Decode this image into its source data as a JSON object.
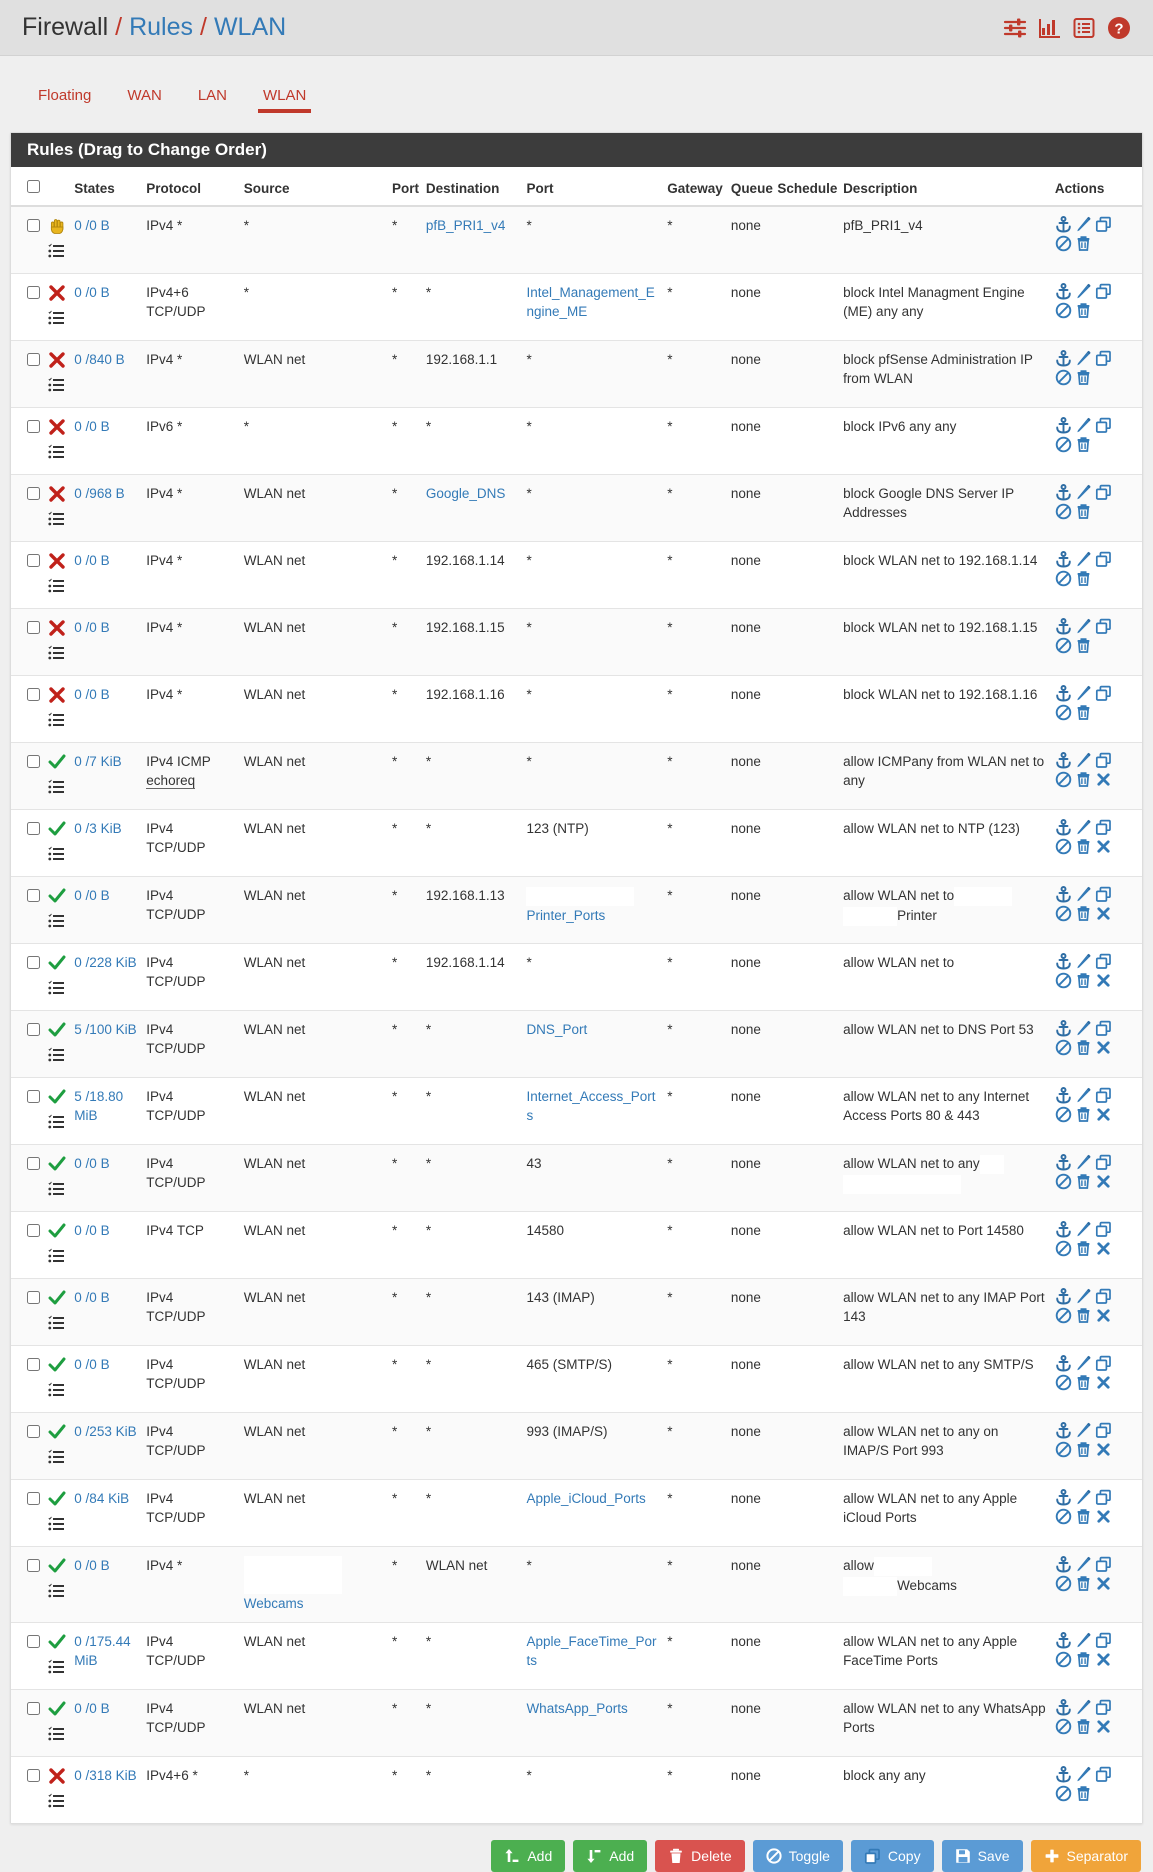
{
  "header": {
    "breadcrumb": {
      "root": "Firewall",
      "sep": "/",
      "section": "Rules",
      "page": "WLAN"
    },
    "icons": [
      {
        "name": "advanced-filter-icon",
        "label": "Advanced Filter"
      },
      {
        "name": "chart-icon",
        "label": "Traffic Graph"
      },
      {
        "name": "list-icon",
        "label": "Log"
      },
      {
        "name": "help-icon",
        "label": "Help"
      }
    ],
    "accent_color": "#c0392b",
    "link_color": "#337ab7"
  },
  "tabs": [
    {
      "label": "Floating",
      "active": false
    },
    {
      "label": "WAN",
      "active": false
    },
    {
      "label": "LAN",
      "active": false
    },
    {
      "label": "WLAN",
      "active": true
    }
  ],
  "panel": {
    "title": "Rules (Drag to Change Order)"
  },
  "table": {
    "columns": [
      "",
      "",
      "States",
      "Protocol",
      "Source",
      "Port",
      "Destination",
      "Port",
      "Gateway",
      "Queue",
      "Schedule",
      "Description",
      "Actions"
    ],
    "headers": {
      "states": "States",
      "protocol": "Protocol",
      "source": "Source",
      "port_src": "Port",
      "destination": "Destination",
      "port_dst": "Port",
      "gateway": "Gateway",
      "queue": "Queue",
      "schedule": "Schedule",
      "description": "Description",
      "actions": "Actions"
    },
    "rows": [
      {
        "action_icon": "reject-hand-icon",
        "action_type": "reject",
        "states": "0 /0 B",
        "protocol": "IPv4 *",
        "source": "*",
        "source_link": false,
        "port_src": "*",
        "destination": "pfB_PRI1_v4",
        "destination_link": true,
        "port_dst": "*",
        "port_dst_link": false,
        "gateway": "*",
        "queue": "none",
        "schedule": "",
        "description": "pfB_PRI1_v4",
        "actions": [
          "anchor-icon",
          "edit-icon",
          "copy-icon",
          "disable-icon",
          "delete-icon"
        ]
      },
      {
        "action_icon": "block-x-icon",
        "action_type": "block",
        "states": "0 /0 B",
        "protocol": "IPv4+6 TCP/UDP",
        "source": "*",
        "source_link": false,
        "port_src": "*",
        "destination": "*",
        "destination_link": false,
        "port_dst": "Intel_Management_Engine_ME",
        "port_dst_link": true,
        "gateway": "*",
        "queue": "none",
        "schedule": "",
        "description": "block Intel Managment Engine (ME) any any",
        "actions": [
          "anchor-icon",
          "edit-icon",
          "copy-icon",
          "disable-icon",
          "delete-icon"
        ]
      },
      {
        "action_icon": "block-x-icon",
        "action_type": "block",
        "states": "0 /840 B",
        "protocol": "IPv4 *",
        "source": "WLAN net",
        "source_link": false,
        "port_src": "*",
        "destination": "192.168.1.1",
        "destination_link": false,
        "port_dst": "*",
        "port_dst_link": false,
        "gateway": "*",
        "queue": "none",
        "schedule": "",
        "description": "block pfSense Administration IP from WLAN",
        "actions": [
          "anchor-icon",
          "edit-icon",
          "copy-icon",
          "disable-icon",
          "delete-icon"
        ]
      },
      {
        "action_icon": "block-x-icon",
        "action_type": "block",
        "states": "0 /0 B",
        "protocol": "IPv6 *",
        "source": "*",
        "source_link": false,
        "port_src": "*",
        "destination": "*",
        "destination_link": false,
        "port_dst": "*",
        "port_dst_link": false,
        "gateway": "*",
        "queue": "none",
        "schedule": "",
        "description": "block IPv6 any any",
        "actions": [
          "anchor-icon",
          "edit-icon",
          "copy-icon",
          "disable-icon",
          "delete-icon"
        ]
      },
      {
        "action_icon": "block-x-icon",
        "action_type": "block",
        "states": "0 /968 B",
        "protocol": "IPv4 *",
        "source": "WLAN net",
        "source_link": false,
        "port_src": "*",
        "destination": "Google_DNS",
        "destination_link": true,
        "port_dst": "*",
        "port_dst_link": false,
        "gateway": "*",
        "queue": "none",
        "schedule": "",
        "description": "block Google DNS Server IP Addresses",
        "actions": [
          "anchor-icon",
          "edit-icon",
          "copy-icon",
          "disable-icon",
          "delete-icon"
        ]
      },
      {
        "action_icon": "block-x-icon",
        "action_type": "block",
        "states": "0 /0 B",
        "protocol": "IPv4 *",
        "source": "WLAN net",
        "source_link": false,
        "port_src": "*",
        "destination": "192.168.1.14",
        "destination_link": false,
        "port_dst": "*",
        "port_dst_link": false,
        "gateway": "*",
        "queue": "none",
        "schedule": "",
        "description": "block WLAN net to 192.168.1.14",
        "actions": [
          "anchor-icon",
          "edit-icon",
          "copy-icon",
          "disable-icon",
          "delete-icon"
        ]
      },
      {
        "action_icon": "block-x-icon",
        "action_type": "block",
        "states": "0 /0 B",
        "protocol": "IPv4 *",
        "source": "WLAN net",
        "source_link": false,
        "port_src": "*",
        "destination": "192.168.1.15",
        "destination_link": false,
        "port_dst": "*",
        "port_dst_link": false,
        "gateway": "*",
        "queue": "none",
        "schedule": "",
        "description": "block WLAN net to 192.168.1.15",
        "actions": [
          "anchor-icon",
          "edit-icon",
          "copy-icon",
          "disable-icon",
          "delete-icon"
        ]
      },
      {
        "action_icon": "block-x-icon",
        "action_type": "block",
        "states": "0 /0 B",
        "protocol": "IPv4 *",
        "source": "WLAN net",
        "source_link": false,
        "port_src": "*",
        "destination": "192.168.1.16",
        "destination_link": false,
        "port_dst": "*",
        "port_dst_link": false,
        "gateway": "*",
        "queue": "none",
        "schedule": "",
        "description": "block WLAN net to 192.168.1.16",
        "actions": [
          "anchor-icon",
          "edit-icon",
          "copy-icon",
          "disable-icon",
          "delete-icon"
        ]
      },
      {
        "action_icon": "pass-check-icon",
        "action_type": "pass",
        "states": "0 /7 KiB",
        "protocol": "IPv4 ICMP",
        "protocol_abbr": "echoreq",
        "source": "WLAN net",
        "source_link": false,
        "port_src": "*",
        "destination": "*",
        "destination_link": false,
        "port_dst": "*",
        "port_dst_link": false,
        "gateway": "*",
        "queue": "none",
        "schedule": "",
        "description": "allow ICMPany from WLAN net to any",
        "actions": [
          "anchor-icon",
          "edit-icon",
          "copy-icon",
          "disable-icon",
          "delete-icon",
          "remove-x-icon"
        ]
      },
      {
        "action_icon": "pass-check-icon",
        "action_type": "pass",
        "states": "0 /3 KiB",
        "protocol": "IPv4 TCP/UDP",
        "source": "WLAN net",
        "source_link": false,
        "port_src": "*",
        "destination": "*",
        "destination_link": false,
        "port_dst": "123 (NTP)",
        "port_dst_link": false,
        "gateway": "*",
        "queue": "none",
        "schedule": "",
        "description": "allow WLAN net to NTP (123)",
        "actions": [
          "anchor-icon",
          "edit-icon",
          "copy-icon",
          "disable-icon",
          "delete-icon",
          "remove-x-icon"
        ]
      },
      {
        "action_icon": "pass-check-icon",
        "action_type": "pass",
        "states": "0 /0 B",
        "protocol": "IPv4 TCP/UDP",
        "source": "WLAN net",
        "source_link": false,
        "port_src": "*",
        "destination": "192.168.1.13",
        "destination_link": false,
        "port_dst": "Printer_Ports",
        "port_dst_link": true,
        "port_dst_redacted": true,
        "gateway": "*",
        "queue": "none",
        "schedule": "",
        "description": "allow WLAN net to",
        "description_line2": "Printer",
        "description_redacted": true,
        "actions": [
          "anchor-icon",
          "edit-icon",
          "copy-icon",
          "disable-icon",
          "delete-icon",
          "remove-x-icon"
        ]
      },
      {
        "action_icon": "pass-check-icon",
        "action_type": "pass",
        "states": "0 /228 KiB",
        "protocol": "IPv4 TCP/UDP",
        "source": "WLAN net",
        "source_link": false,
        "port_src": "*",
        "destination": "192.168.1.14",
        "destination_link": false,
        "port_dst": "*",
        "port_dst_link": false,
        "gateway": "*",
        "queue": "none",
        "schedule": "",
        "description": "allow WLAN net to",
        "actions": [
          "anchor-icon",
          "edit-icon",
          "copy-icon",
          "disable-icon",
          "delete-icon",
          "remove-x-icon"
        ]
      },
      {
        "action_icon": "pass-check-icon",
        "action_type": "pass",
        "states": "5 /100 KiB",
        "protocol": "IPv4 TCP/UDP",
        "source": "WLAN net",
        "source_link": false,
        "port_src": "*",
        "destination": "*",
        "destination_link": false,
        "port_dst": "DNS_Port",
        "port_dst_link": true,
        "gateway": "*",
        "queue": "none",
        "schedule": "",
        "description": "allow WLAN net to DNS Port 53",
        "actions": [
          "anchor-icon",
          "edit-icon",
          "copy-icon",
          "disable-icon",
          "delete-icon",
          "remove-x-icon"
        ]
      },
      {
        "action_icon": "pass-check-icon",
        "action_type": "pass",
        "states": "5 /18.80 MiB",
        "protocol": "IPv4 TCP/UDP",
        "source": "WLAN net",
        "source_link": false,
        "port_src": "*",
        "destination": "*",
        "destination_link": false,
        "port_dst": "Internet_Access_Ports",
        "port_dst_link": true,
        "gateway": "*",
        "queue": "none",
        "schedule": "",
        "description": "allow WLAN net to any Internet Access Ports 80 & 443",
        "actions": [
          "anchor-icon",
          "edit-icon",
          "copy-icon",
          "disable-icon",
          "delete-icon",
          "remove-x-icon"
        ]
      },
      {
        "action_icon": "pass-check-icon",
        "action_type": "pass",
        "states": "0 /0 B",
        "protocol": "IPv4 TCP/UDP",
        "source": "WLAN net",
        "source_link": false,
        "port_src": "*",
        "destination": "*",
        "destination_link": false,
        "port_dst": "43",
        "port_dst_link": false,
        "gateway": "*",
        "queue": "none",
        "schedule": "",
        "description": "allow WLAN net to any",
        "description_redacted": true,
        "description_redact_wide": true,
        "actions": [
          "anchor-icon",
          "edit-icon",
          "copy-icon",
          "disable-icon",
          "delete-icon",
          "remove-x-icon"
        ]
      },
      {
        "action_icon": "pass-check-icon",
        "action_type": "pass",
        "states": "0 /0 B",
        "protocol": "IPv4 TCP",
        "source": "WLAN net",
        "source_link": false,
        "port_src": "*",
        "destination": "*",
        "destination_link": false,
        "port_dst": "14580",
        "port_dst_link": false,
        "gateway": "*",
        "queue": "none",
        "schedule": "",
        "description": "allow WLAN net to Port 14580",
        "actions": [
          "anchor-icon",
          "edit-icon",
          "copy-icon",
          "disable-icon",
          "delete-icon",
          "remove-x-icon"
        ]
      },
      {
        "action_icon": "pass-check-icon",
        "action_type": "pass",
        "states": "0 /0 B",
        "protocol": "IPv4 TCP/UDP",
        "source": "WLAN net",
        "source_link": false,
        "port_src": "*",
        "destination": "*",
        "destination_link": false,
        "port_dst": "143 (IMAP)",
        "port_dst_link": false,
        "gateway": "*",
        "queue": "none",
        "schedule": "",
        "description": "allow WLAN net to any IMAP Port 143",
        "actions": [
          "anchor-icon",
          "edit-icon",
          "copy-icon",
          "disable-icon",
          "delete-icon",
          "remove-x-icon"
        ]
      },
      {
        "action_icon": "pass-check-icon",
        "action_type": "pass",
        "states": "0 /0 B",
        "protocol": "IPv4 TCP/UDP",
        "source": "WLAN net",
        "source_link": false,
        "port_src": "*",
        "destination": "*",
        "destination_link": false,
        "port_dst": "465 (SMTP/S)",
        "port_dst_link": false,
        "gateway": "*",
        "queue": "none",
        "schedule": "",
        "description": "allow WLAN net to any SMTP/S",
        "actions": [
          "anchor-icon",
          "edit-icon",
          "copy-icon",
          "disable-icon",
          "delete-icon",
          "remove-x-icon"
        ]
      },
      {
        "action_icon": "pass-check-icon",
        "action_type": "pass",
        "states": "0 /253 KiB",
        "protocol": "IPv4 TCP/UDP",
        "source": "WLAN net",
        "source_link": false,
        "port_src": "*",
        "destination": "*",
        "destination_link": false,
        "port_dst": "993 (IMAP/S)",
        "port_dst_link": false,
        "gateway": "*",
        "queue": "none",
        "schedule": "",
        "description": "allow WLAN net to any on IMAP/S Port 993",
        "actions": [
          "anchor-icon",
          "edit-icon",
          "copy-icon",
          "disable-icon",
          "delete-icon",
          "remove-x-icon"
        ]
      },
      {
        "action_icon": "pass-check-icon",
        "action_type": "pass",
        "states": "0 /84 KiB",
        "protocol": "IPv4 TCP/UDP",
        "source": "WLAN net",
        "source_link": false,
        "port_src": "*",
        "destination": "*",
        "destination_link": false,
        "port_dst": "Apple_iCloud_Ports",
        "port_dst_link": true,
        "gateway": "*",
        "queue": "none",
        "schedule": "",
        "description": "allow WLAN net to any Apple iCloud Ports",
        "actions": [
          "anchor-icon",
          "edit-icon",
          "copy-icon",
          "disable-icon",
          "delete-icon",
          "remove-x-icon"
        ]
      },
      {
        "action_icon": "pass-check-icon",
        "action_type": "pass",
        "states": "0 /0 B",
        "protocol": "IPv4 *",
        "source": "Webcams",
        "source_link": true,
        "source_redacted": true,
        "port_src": "*",
        "destination": "WLAN net",
        "destination_link": false,
        "port_dst": "*",
        "port_dst_link": false,
        "gateway": "*",
        "queue": "none",
        "schedule": "",
        "description": "allow",
        "description_line2": "Webcams",
        "description_redacted": true,
        "actions": [
          "anchor-icon",
          "edit-icon",
          "copy-icon",
          "disable-icon",
          "delete-icon",
          "remove-x-icon"
        ]
      },
      {
        "action_icon": "pass-check-icon",
        "action_type": "pass",
        "states": "0 /175.44 MiB",
        "protocol": "IPv4 TCP/UDP",
        "source": "WLAN net",
        "source_link": false,
        "port_src": "*",
        "destination": "*",
        "destination_link": false,
        "port_dst": "Apple_FaceTime_Ports",
        "port_dst_link": true,
        "gateway": "*",
        "queue": "none",
        "schedule": "",
        "description": "allow WLAN net to any Apple FaceTime Ports",
        "actions": [
          "anchor-icon",
          "edit-icon",
          "copy-icon",
          "disable-icon",
          "delete-icon",
          "remove-x-icon"
        ]
      },
      {
        "action_icon": "pass-check-icon",
        "action_type": "pass",
        "states": "0 /0 B",
        "protocol": "IPv4 TCP/UDP",
        "source": "WLAN net",
        "source_link": false,
        "port_src": "*",
        "destination": "*",
        "destination_link": false,
        "port_dst": "WhatsApp_Ports",
        "port_dst_link": true,
        "gateway": "*",
        "queue": "none",
        "schedule": "",
        "description": "allow WLAN net to any WhatsApp Ports",
        "actions": [
          "anchor-icon",
          "edit-icon",
          "copy-icon",
          "disable-icon",
          "delete-icon",
          "remove-x-icon"
        ]
      },
      {
        "action_icon": "block-x-icon",
        "action_type": "block",
        "states": "0 /318 KiB",
        "protocol": "IPv4+6 *",
        "source": "*",
        "source_link": false,
        "port_src": "*",
        "destination": "*",
        "destination_link": false,
        "port_dst": "*",
        "port_dst_link": false,
        "gateway": "*",
        "queue": "none",
        "schedule": "",
        "description": "block any any",
        "actions": [
          "anchor-icon",
          "edit-icon",
          "copy-icon",
          "disable-icon",
          "delete-icon"
        ]
      }
    ]
  },
  "footer_buttons": [
    {
      "label": "Add",
      "icon": "arrow-up-icon",
      "color": "#4caf50",
      "style": "btn-green"
    },
    {
      "label": "Add",
      "icon": "arrow-down-icon",
      "color": "#4caf50",
      "style": "btn-green"
    },
    {
      "label": "Delete",
      "icon": "trash-icon",
      "color": "#d9534f",
      "style": "btn-red"
    },
    {
      "label": "Toggle",
      "icon": "ban-icon",
      "color": "#5b9bd5",
      "style": "btn-blue"
    },
    {
      "label": "Copy",
      "icon": "copy-icon",
      "color": "#5b9bd5",
      "style": "btn-blue"
    },
    {
      "label": "Save",
      "icon": "save-icon",
      "color": "#5b9bd5",
      "style": "btn-blue"
    },
    {
      "label": "Separator",
      "icon": "plus-icon",
      "color": "#f0a43a",
      "style": "btn-orange"
    }
  ]
}
